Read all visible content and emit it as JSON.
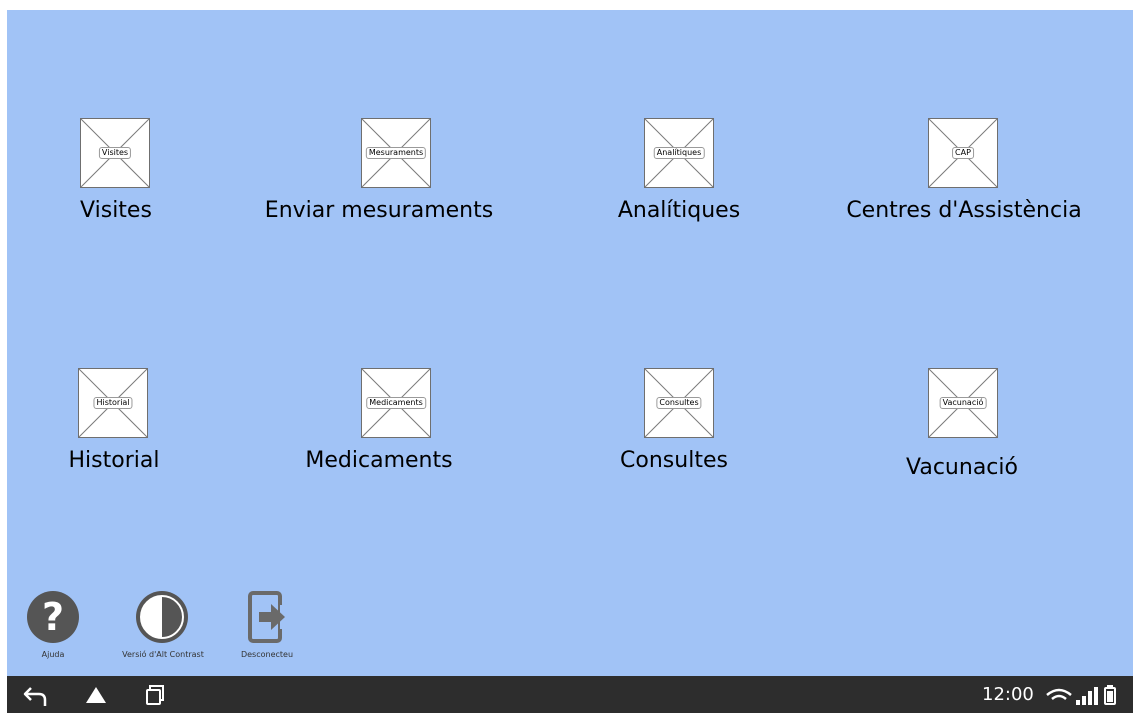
{
  "tiles": [
    {
      "tag": "Visites",
      "label": "Visites"
    },
    {
      "tag": "Mesuraments",
      "label": "Enviar mesuraments"
    },
    {
      "tag": "Analítiques",
      "label": "Analítiques"
    },
    {
      "tag": "CAP",
      "label": "Centres d'Assistència"
    },
    {
      "tag": "Historial",
      "label": "Historial"
    },
    {
      "tag": "Medicaments",
      "label": "Medicaments"
    },
    {
      "tag": "Consultes",
      "label": "Consultes"
    },
    {
      "tag": "Vacunació",
      "label": "Vacunació"
    }
  ],
  "toolbar": {
    "help_label": "Ajuda",
    "contrast_label": "Versió d'Alt Contrast",
    "logout_label": "Desconecteu"
  },
  "status_bar": {
    "time": "12:00"
  },
  "colors": {
    "background": "#a1c3f6",
    "navbar": "#2d2d2d",
    "icon_dark": "#555555"
  }
}
